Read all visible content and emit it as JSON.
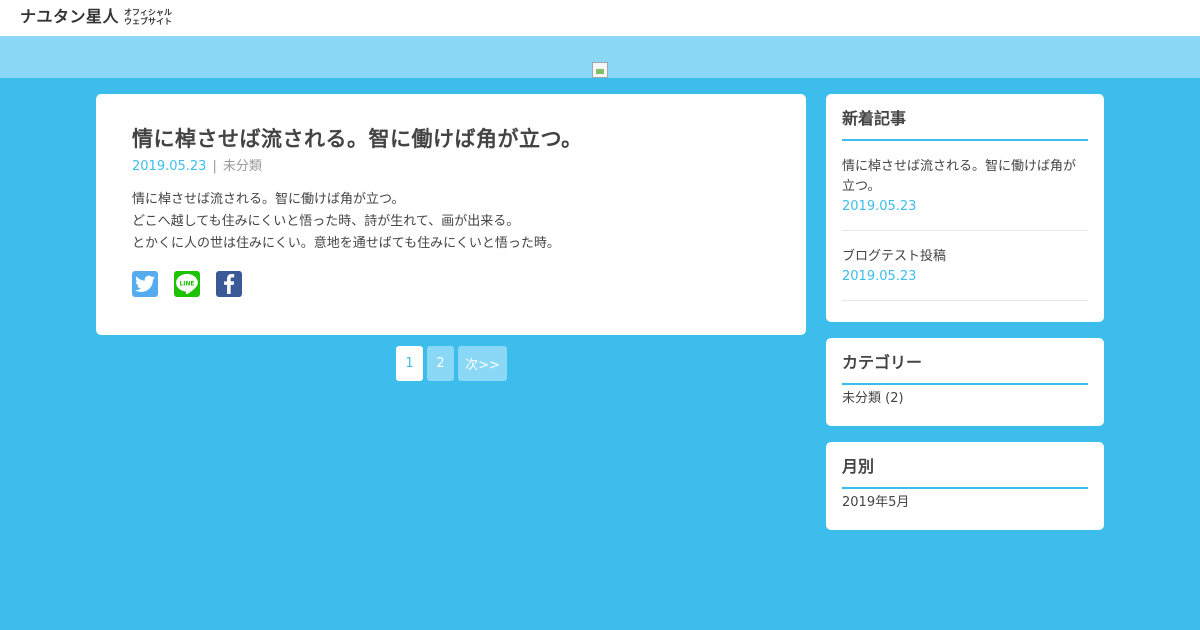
{
  "header": {
    "logo_main": "ナユタン星人",
    "logo_sub_1": "オフィシャル",
    "logo_sub_2": "ウェブサイト"
  },
  "post": {
    "title": "情に棹させば流される。智に働けば角が立つ。",
    "date": "2019.05.23",
    "separator": "|",
    "category": "未分類",
    "body": [
      "情に棹させば流される。智に働けば角が立つ。",
      "どこへ越しても住みにくいと悟った時、詩が生れて、画が出来る。",
      "とかくに人の世は住みにくい。意地を通せばても住みにくいと悟った時。"
    ],
    "share": [
      {
        "icon": "twitter-icon",
        "color": "#55acee"
      },
      {
        "icon": "line-icon",
        "color": "#1dc200",
        "label": "LINE"
      },
      {
        "icon": "facebook-icon",
        "color": "#3b5998"
      }
    ]
  },
  "pagination": {
    "current": "1",
    "page2": "2",
    "next": "次>>"
  },
  "sidebar": {
    "recent": {
      "title": "新着記事",
      "items": [
        {
          "title": "情に棹させば流される。智に働けば角が立つ。",
          "date": "2019.05.23"
        },
        {
          "title": "ブログテスト投稿",
          "date": "2019.05.23"
        }
      ]
    },
    "categories": {
      "title": "カテゴリー",
      "items": [
        {
          "label": "未分類 (2)"
        }
      ]
    },
    "monthly": {
      "title": "月別",
      "items": [
        {
          "label": "2019年5月"
        }
      ]
    }
  },
  "colors": {
    "background": "#3dbdec",
    "hero": "#8bd8f6",
    "accent": "#3dbdec"
  }
}
